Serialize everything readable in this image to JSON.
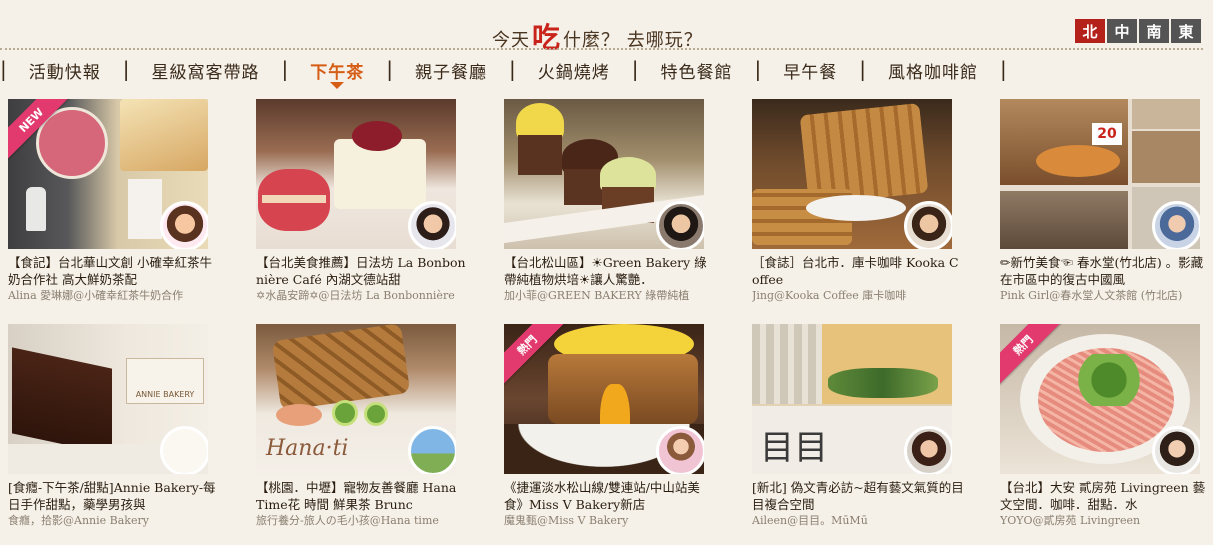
{
  "header": {
    "headline_before": "今天",
    "headline_big": "吃",
    "headline_after": "什麼？ 去哪玩？",
    "regions": [
      "北",
      "中",
      "南",
      "東"
    ],
    "active_region": "北",
    "accent_color": "#b4211b"
  },
  "nav": {
    "items": [
      "活動快報",
      "星級窩客帶路",
      "下午茶",
      "親子餐廳",
      "火鍋燒烤",
      "特色餐館",
      "早午餐",
      "風格咖啡館"
    ],
    "active": "下午茶",
    "active_color": "#d65d16"
  },
  "cards": [
    {
      "title": "【食記】台北華山文創 小確幸紅茶牛奶合作社 高大鮮奶茶配",
      "author": "Alina 愛琳娜@小確幸紅茶牛奶合作",
      "badge": "NEW",
      "avatar_icon": "blogger-avatar-icon"
    },
    {
      "title": "【台北美食推薦】日法坊 La Bonbonnière Café 內湖文德站甜",
      "author": "✡水晶安蹄✡@日法坊 La Bonbonnière",
      "badge": "",
      "avatar_icon": "blogger-avatar-icon"
    },
    {
      "title": "【台北松山區】☀Green Bakery 綠帶純植物烘培☀讓人驚艷．",
      "author": "加小菲@GREEN BAKERY 綠帶純植",
      "badge": "",
      "avatar_icon": "blogger-avatar-icon"
    },
    {
      "title": "［食誌］台北市．庫卡咖啡 Kooka Coffee",
      "author": "Jing@Kooka Coffee 庫卡咖啡",
      "badge": "",
      "avatar_icon": "blogger-avatar-icon"
    },
    {
      "title": "✏新竹美食☜ 春水堂(竹北店) 。影藏在市區中的復古中國風",
      "author": "Pink Girl@春水堂人文茶館 (竹北店)",
      "badge": "",
      "avatar_icon": "blogger-avatar-icon"
    },
    {
      "title": "[食癮-下午茶/甜點]Annie Bakery-每日手作甜點，藥學男孩與",
      "author": "食癮，拾影@Annie Bakery",
      "badge": "",
      "avatar_icon": "blogger-avatar-icon"
    },
    {
      "title": "【桃園．中壢】寵物友善餐廳 Hana Time花 時間 鮮果茶 Brunc",
      "author": "旅行養分-旅人の毛小孩@Hana time",
      "badge": "",
      "avatar_icon": "blogger-avatar-icon"
    },
    {
      "title": "《捷運淡水松山線/雙連站/中山站美食》Miss V Bakery新店",
      "author": "魔鬼甄@Miss V Bakery",
      "badge": "熱門",
      "avatar_icon": "blogger-avatar-icon"
    },
    {
      "title": "[新北] 偽文青必訪~超有藝文氣質的目目複合空間",
      "author": "Aileen@目目。MūMū",
      "badge": "",
      "avatar_icon": "blogger-avatar-icon"
    },
    {
      "title": "【台北】大安 貳房苑 Livingreen 藝文空間．咖啡．甜點．水",
      "author": "YOYO@貳房苑 Livingreen",
      "badge": "熱門",
      "avatar_icon": "blogger-avatar-icon"
    }
  ]
}
